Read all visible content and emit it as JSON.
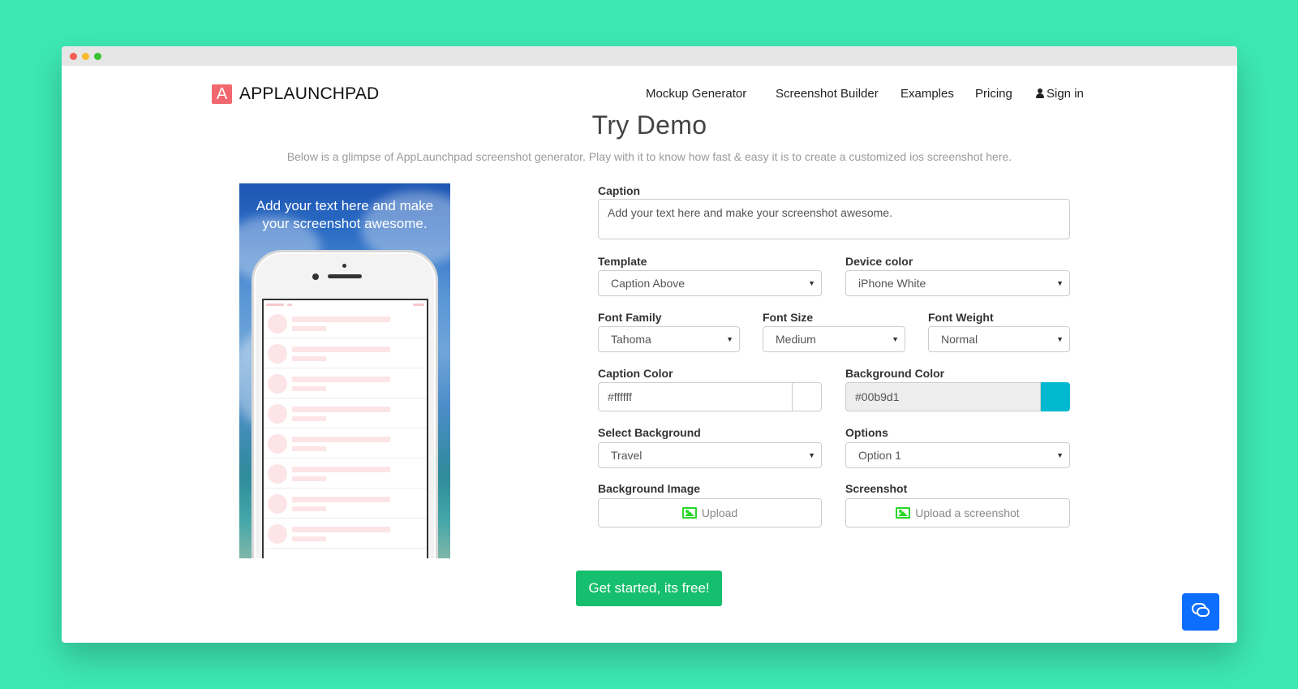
{
  "brand": {
    "logo_letter": "A",
    "name": "APPLAUNCHPAD"
  },
  "nav": {
    "items": [
      "Mockup Generator",
      "Screenshot Builder",
      "Examples",
      "Pricing"
    ],
    "signin": "Sign in"
  },
  "hero": {
    "title": "Try Demo",
    "subtitle": "Below is a glimpse of AppLaunchpad screenshot generator. Play with it to know how fast & easy it is to create a customized ios screenshot here."
  },
  "preview": {
    "caption_line1": "Add your text here and make",
    "caption_line2": "your screenshot awesome."
  },
  "form": {
    "caption_label": "Caption",
    "caption_value": "Add your text here and make your screenshot awesome.",
    "template_label": "Template",
    "template_value": "Caption Above",
    "device_color_label": "Device color",
    "device_color_value": "iPhone White",
    "font_family_label": "Font Family",
    "font_family_value": "Tahoma",
    "font_size_label": "Font Size",
    "font_size_value": "Medium",
    "font_weight_label": "Font Weight",
    "font_weight_value": "Normal",
    "caption_color_label": "Caption Color",
    "caption_color_value": "#ffffff",
    "background_color_label": "Background Color",
    "background_color_value": "#00b9d1",
    "select_background_label": "Select Background",
    "select_background_value": "Travel",
    "options_label": "Options",
    "options_value": "Option 1",
    "background_image_label": "Background Image",
    "background_image_button": "Upload",
    "screenshot_label": "Screenshot",
    "screenshot_button": "Upload a screenshot"
  },
  "cta": "Get started, its free!",
  "colors": {
    "background": "#3de8b2",
    "brand": "#f2676e",
    "cta": "#16bf6d",
    "chat": "#0d6efd",
    "swatch_caption": "#ffffff",
    "swatch_background": "#00b9d1"
  },
  "icons": [
    "user-icon",
    "image-icon",
    "chat-icon",
    "caret-down-icon"
  ]
}
